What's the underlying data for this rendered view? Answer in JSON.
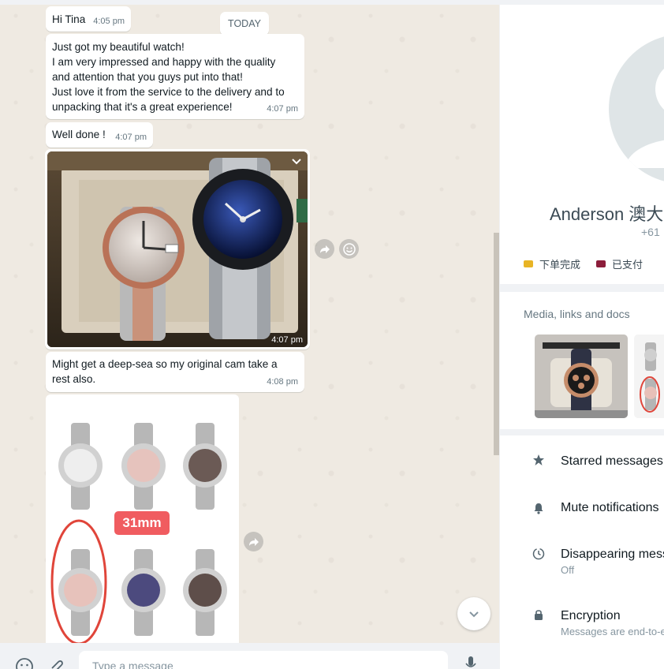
{
  "chat": {
    "today_label": "TODAY",
    "messages": [
      {
        "text": "Hi Tina",
        "time": "4:05 pm"
      },
      {
        "text": "Just got my beautiful watch!\nI am very impressed and happy with the quality\nand attention that you guys put into that!\nJust love it from the service to the delivery and to\nunpacking that it's a great experience!",
        "time": "4:07 pm"
      },
      {
        "text": "Well done !",
        "time": "4:07 pm"
      },
      {
        "type": "image",
        "time": "4:07 pm"
      },
      {
        "text": "Might get a deep-sea so my original cam take a\nrest also.",
        "time": "4:08 pm"
      },
      {
        "type": "image",
        "badge": "31mm"
      }
    ],
    "composer_placeholder": "Type a message",
    "icons": [
      "emoji-icon",
      "attach-icon",
      "mic-icon",
      "forward-icon",
      "react-icon",
      "chevron-down-icon"
    ]
  },
  "contact": {
    "name": "Anderson 澳大",
    "phone": "+61",
    "labels": [
      {
        "text": "下单完成",
        "color": "#e8b425"
      },
      {
        "text": "已支付",
        "color": "#8c1d3b"
      }
    ],
    "media_title": "Media, links and docs",
    "menu": [
      {
        "label": "Starred messages",
        "sub": "",
        "icon": "star-icon"
      },
      {
        "label": "Mute notifications",
        "sub": "",
        "icon": "bell-icon"
      },
      {
        "label": "Disappearing messages",
        "sub": "Off",
        "icon": "timer-icon"
      },
      {
        "label": "Encryption",
        "sub": "Messages are end-to-end encrypted",
        "icon": "lock-icon"
      }
    ]
  },
  "colors": {
    "chat_bg": "#efeae2",
    "bubble_bg": "#ffffff",
    "timestamp": "#667781",
    "badge_red": "#f05c60"
  }
}
